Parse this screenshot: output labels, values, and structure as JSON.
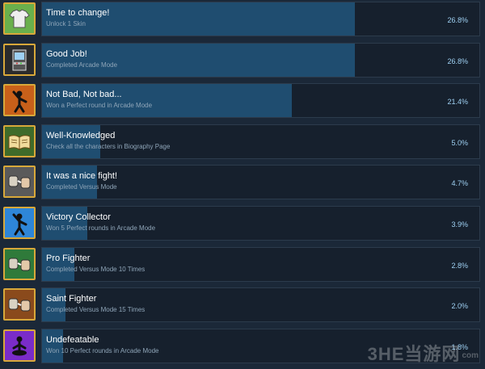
{
  "achievements": [
    {
      "title": "Time to change!",
      "description": "Unlock 1 Skin",
      "percent": "26.8%",
      "rate": 26.8,
      "icon": "shirt-icon",
      "badge_color": "#6ab04c"
    },
    {
      "title": "Good Job!",
      "description": "Completed Arcade Mode",
      "percent": "26.8%",
      "rate": 26.8,
      "icon": "arcade-cabinet-icon",
      "badge_color": "#2b2b2b"
    },
    {
      "title": "Not Bad, Not bad...",
      "description": "Won a Perfect round in Arcade Mode",
      "percent": "21.4%",
      "rate": 21.4,
      "icon": "victory-pose-icon",
      "badge_color": "#c8601a"
    },
    {
      "title": "Well-Knowledged",
      "description": "Check all the characters in Biography Page",
      "percent": "5.0%",
      "rate": 5.0,
      "icon": "open-book-icon",
      "badge_color": "#3f6b2a"
    },
    {
      "title": "It was a nice fight!",
      "description": "Completed Versus Mode",
      "percent": "4.7%",
      "rate": 4.7,
      "icon": "fist-bump-icon",
      "badge_color": "#5a5a5a"
    },
    {
      "title": "Victory Collector",
      "description": "Won 5 Perfect rounds in Arcade Mode",
      "percent": "3.9%",
      "rate": 3.9,
      "icon": "victory-pose-icon",
      "badge_color": "#2e86d8"
    },
    {
      "title": "Pro Fighter",
      "description": "Completed Versus Mode 10 Times",
      "percent": "2.8%",
      "rate": 2.8,
      "icon": "fist-bump-icon",
      "badge_color": "#2f7a3a"
    },
    {
      "title": "Saint Fighter",
      "description": "Completed Versus Mode 15 Times",
      "percent": "2.0%",
      "rate": 2.0,
      "icon": "fist-bump-icon",
      "badge_color": "#8a4a1c"
    },
    {
      "title": "Undefeatable",
      "description": "Won 10 Perfect rounds in Arcade Mode",
      "percent": "1.8%",
      "rate": 1.8,
      "icon": "meditating-figure-icon",
      "badge_color": "#7a2cc8"
    }
  ],
  "watermark": {
    "main": "3HE当游网",
    "sub": "com"
  }
}
